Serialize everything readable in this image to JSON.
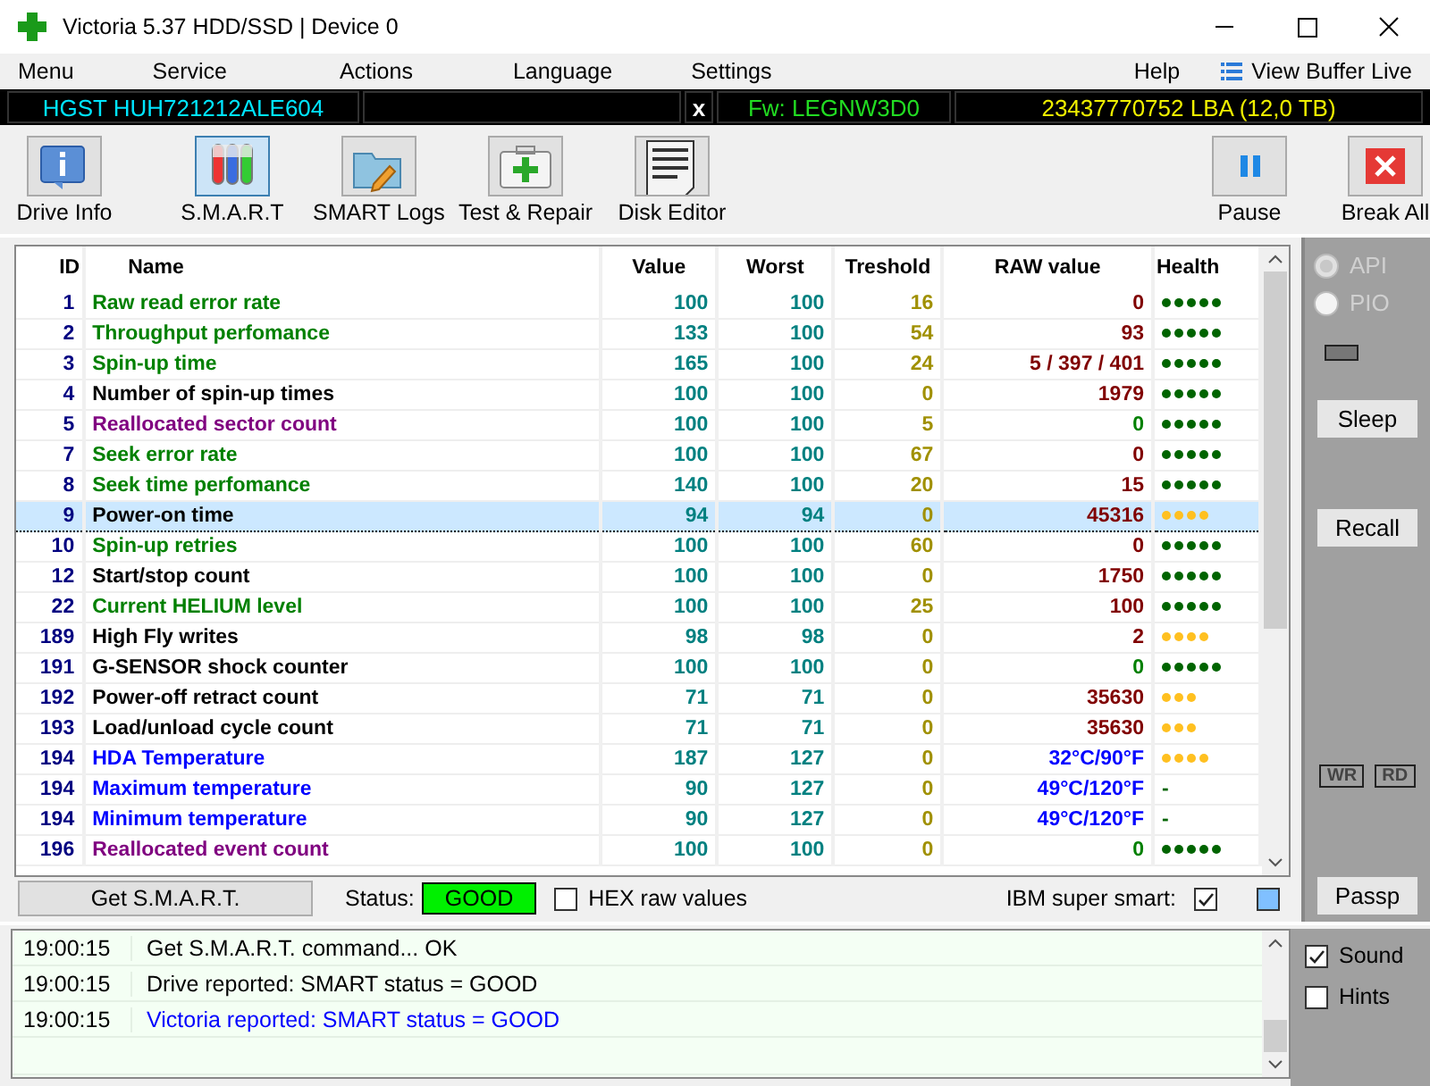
{
  "window": {
    "title": "Victoria 5.37 HDD/SSD | Device 0"
  },
  "menu": {
    "items": [
      "Menu",
      "Service",
      "Actions",
      "Language",
      "Settings"
    ],
    "help": "Help",
    "view_buffer": "View Buffer Live"
  },
  "drive_bar": {
    "model": "HGST  HUH721212ALE604",
    "close": "x",
    "firmware": "Fw: LEGNW3D0",
    "capacity": "23437770752 LBA (12,0 TB)"
  },
  "toolbar": [
    {
      "label": "Drive Info",
      "kind": "info",
      "selected": false
    },
    {
      "label": "S.M.A.R.T",
      "kind": "smart",
      "selected": true
    },
    {
      "label": "SMART Logs",
      "kind": "logs",
      "selected": false
    },
    {
      "label": "Test & Repair",
      "kind": "repair",
      "selected": false
    },
    {
      "label": "Disk Editor",
      "kind": "editor",
      "selected": false
    },
    {
      "label": "Pause",
      "kind": "pause",
      "selected": false
    },
    {
      "label": "Break All",
      "kind": "stop",
      "selected": false
    }
  ],
  "table": {
    "columns": [
      "ID",
      "Name",
      "Value",
      "Worst",
      "Treshold",
      "RAW value",
      "Health"
    ],
    "rows": [
      {
        "id": "1",
        "name": "Raw read error rate",
        "color": "#008000",
        "value": "100",
        "worst": "100",
        "threshold": "16",
        "raw": {
          "text": "0",
          "color": "#800000"
        },
        "health": {
          "stars": 5,
          "color": "#006400"
        },
        "selected": false
      },
      {
        "id": "2",
        "name": "Throughput perfomance",
        "color": "#008000",
        "value": "133",
        "worst": "100",
        "threshold": "54",
        "raw": {
          "text": "93",
          "color": "#800000"
        },
        "health": {
          "stars": 5,
          "color": "#006400"
        },
        "selected": false
      },
      {
        "id": "3",
        "name": "Spin-up time",
        "color": "#008000",
        "value": "165",
        "worst": "100",
        "threshold": "24",
        "raw": {
          "text": "5 / 397 / 401",
          "color": "#800000"
        },
        "health": {
          "stars": 5,
          "color": "#006400"
        },
        "selected": false
      },
      {
        "id": "4",
        "name": "Number of spin-up times",
        "color": "#000000",
        "value": "100",
        "worst": "100",
        "threshold": "0",
        "raw": {
          "text": "1979",
          "color": "#800000"
        },
        "health": {
          "stars": 5,
          "color": "#006400"
        },
        "selected": false
      },
      {
        "id": "5",
        "name": "Reallocated sector count",
        "color": "#800080",
        "value": "100",
        "worst": "100",
        "threshold": "5",
        "raw": {
          "text": "0",
          "color": "#008000"
        },
        "health": {
          "stars": 5,
          "color": "#006400"
        },
        "selected": false
      },
      {
        "id": "7",
        "name": "Seek error rate",
        "color": "#008000",
        "value": "100",
        "worst": "100",
        "threshold": "67",
        "raw": {
          "text": "0",
          "color": "#800000"
        },
        "health": {
          "stars": 5,
          "color": "#006400"
        },
        "selected": false
      },
      {
        "id": "8",
        "name": "Seek time perfomance",
        "color": "#008000",
        "value": "140",
        "worst": "100",
        "threshold": "20",
        "raw": {
          "text": "15",
          "color": "#800000"
        },
        "health": {
          "stars": 5,
          "color": "#006400"
        },
        "selected": false
      },
      {
        "id": "9",
        "name": "Power-on time",
        "color": "#000000",
        "value": "94",
        "worst": "94",
        "threshold": "0",
        "raw": {
          "text": "45316",
          "color": "#800000"
        },
        "health": {
          "stars": 4,
          "color": "#ffc020"
        },
        "selected": true
      },
      {
        "id": "10",
        "name": "Spin-up retries",
        "color": "#008000",
        "value": "100",
        "worst": "100",
        "threshold": "60",
        "raw": {
          "text": "0",
          "color": "#800000"
        },
        "health": {
          "stars": 5,
          "color": "#006400"
        },
        "selected": false
      },
      {
        "id": "12",
        "name": "Start/stop count",
        "color": "#000000",
        "value": "100",
        "worst": "100",
        "threshold": "0",
        "raw": {
          "text": "1750",
          "color": "#800000"
        },
        "health": {
          "stars": 5,
          "color": "#006400"
        },
        "selected": false
      },
      {
        "id": "22",
        "name": "Current HELIUM level",
        "color": "#008000",
        "value": "100",
        "worst": "100",
        "threshold": "25",
        "raw": {
          "text": "100",
          "color": "#800000"
        },
        "health": {
          "stars": 5,
          "color": "#006400"
        },
        "selected": false
      },
      {
        "id": "189",
        "name": "High Fly writes",
        "color": "#000000",
        "value": "98",
        "worst": "98",
        "threshold": "0",
        "raw": {
          "text": "2",
          "color": "#800000"
        },
        "health": {
          "stars": 4,
          "color": "#ffc020"
        },
        "selected": false
      },
      {
        "id": "191",
        "name": "G-SENSOR shock counter",
        "color": "#000000",
        "value": "100",
        "worst": "100",
        "threshold": "0",
        "raw": {
          "text": "0",
          "color": "#008000"
        },
        "health": {
          "stars": 5,
          "color": "#006400"
        },
        "selected": false
      },
      {
        "id": "192",
        "name": "Power-off retract count",
        "color": "#000000",
        "value": "71",
        "worst": "71",
        "threshold": "0",
        "raw": {
          "text": "35630",
          "color": "#800000"
        },
        "health": {
          "stars": 3,
          "color": "#ffc020"
        },
        "selected": false
      },
      {
        "id": "193",
        "name": "Load/unload cycle count",
        "color": "#000000",
        "value": "71",
        "worst": "71",
        "threshold": "0",
        "raw": {
          "text": "35630",
          "color": "#800000"
        },
        "health": {
          "stars": 3,
          "color": "#ffc020"
        },
        "selected": false
      },
      {
        "id": "194",
        "name": "HDA Temperature",
        "color": "#0000ff",
        "value": "187",
        "worst": "127",
        "threshold": "0",
        "raw": {
          "text": "32°C/90°F",
          "color": "#0000ff"
        },
        "health": {
          "stars": 4,
          "color": "#ffc020"
        },
        "selected": false
      },
      {
        "id": "194",
        "name": "Maximum temperature",
        "color": "#0000ff",
        "value": "90",
        "worst": "127",
        "threshold": "0",
        "raw": {
          "text": "49°C/120°F",
          "color": "#0000ff"
        },
        "health": {
          "text": "-"
        },
        "selected": false
      },
      {
        "id": "194",
        "name": "Minimum temperature",
        "color": "#0000ff",
        "value": "90",
        "worst": "127",
        "threshold": "0",
        "raw": {
          "text": "49°C/120°F",
          "color": "#0000ff"
        },
        "health": {
          "text": "-"
        },
        "selected": false
      },
      {
        "id": "196",
        "name": "Reallocated event count",
        "color": "#800080",
        "value": "100",
        "worst": "100",
        "threshold": "0",
        "raw": {
          "text": "0",
          "color": "#008000"
        },
        "health": {
          "stars": 5,
          "color": "#006400"
        },
        "selected": false
      }
    ]
  },
  "side_panel": {
    "radios": [
      {
        "label": "API",
        "selected": true,
        "disabled": true
      },
      {
        "label": "PIO",
        "selected": false,
        "disabled": true
      }
    ],
    "buttons": [
      "Sleep",
      "Recall"
    ],
    "io": [
      "WR",
      "RD"
    ],
    "bottom_button": "Passp"
  },
  "smart_bar": {
    "button": "Get S.M.A.R.T.",
    "status_label": "Status:",
    "status": "GOOD",
    "hex": {
      "label": "HEX raw values",
      "checked": false
    },
    "ibm": {
      "label": "IBM super smart:",
      "checked": true
    }
  },
  "log": [
    {
      "time": "19:00:15",
      "message": "Get S.M.A.R.T. command... OK",
      "color": "#000000"
    },
    {
      "time": "19:00:15",
      "message": "Drive reported: SMART status = GOOD",
      "color": "#000000"
    },
    {
      "time": "19:00:15",
      "message": "Victoria reported: SMART status = GOOD",
      "color": "#0000ff"
    }
  ],
  "options": [
    {
      "label": "Sound",
      "checked": true
    },
    {
      "label": "Hints",
      "checked": false
    }
  ]
}
